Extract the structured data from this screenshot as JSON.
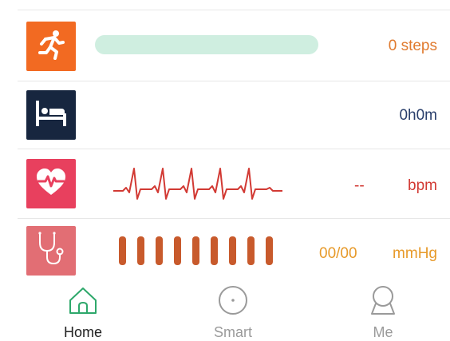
{
  "colors": {
    "steps_tile": "#f26a22",
    "sleep_tile": "#17263f",
    "heart_tile": "#e8405e",
    "bp_tile": "#e26e74",
    "steps_text": "#e07a2e",
    "sleep_text": "#2a3f6c",
    "heart_text": "#d23a34",
    "bp_text": "#e79a2a",
    "progress_track": "#cfeee0",
    "bp_bars": "#c85a2c",
    "nav_active": "#2ea86b",
    "nav_inactive": "#9a9a9a"
  },
  "rows": {
    "steps": {
      "icon": "running-person-icon",
      "value": "0 steps",
      "progress": 0
    },
    "sleep": {
      "icon": "bed-icon",
      "value": "0h0m"
    },
    "heart_rate": {
      "icon": "heart-pulse-icon",
      "value": "--",
      "unit": "bpm"
    },
    "blood_pressure": {
      "icon": "stethoscope-icon",
      "value": "00/00",
      "unit": "mmHg",
      "bar_count": 9
    }
  },
  "nav": {
    "home": {
      "label": "Home",
      "icon": "home-icon",
      "active": true
    },
    "smart": {
      "label": "Smart",
      "icon": "smart-circle-icon",
      "active": false
    },
    "me": {
      "label": "Me",
      "icon": "person-icon",
      "active": false
    }
  }
}
